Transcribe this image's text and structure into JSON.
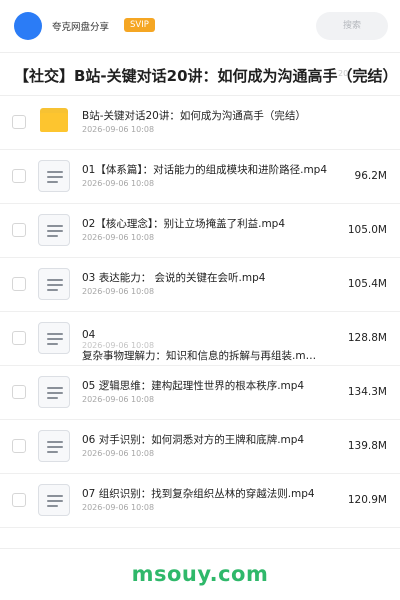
{
  "header": {
    "owner_name": "夸克网盘分享",
    "badge": "SVIP",
    "search_placeholder": "搜索"
  },
  "folder_title": "【社交】B站-关键对话20讲：如何成为沟通高手（完结）",
  "title_overlap_text": "20",
  "files": [
    {
      "name": "B站-关键对话20讲：如何成为沟通高手（完结）",
      "date": "2026-09-06 10:08",
      "size": "",
      "type": "folder"
    },
    {
      "name": "01【体系篇】：对话能力的组成模块和进阶路径.mp4",
      "date": "2026-09-06 10:08",
      "size": "96.2M",
      "type": "file"
    },
    {
      "name": "02【核心理念】：别让立场掩盖了利益.mp4",
      "date": "2026-09-06 10:08",
      "size": "105.0M",
      "type": "file"
    },
    {
      "name": "03 表达能力： 会说的关键在会听.mp4",
      "date": "2026-09-06 10:08",
      "size": "105.4M",
      "type": "file"
    },
    {
      "name": "04",
      "name_line2": "复杂事物理解力：知识和信息的拆解与再组装.m…",
      "date": "2026-09-06 10:08",
      "size": "128.8M",
      "type": "file"
    },
    {
      "name": "05 逻辑思维：建构起理性世界的根本秩序.mp4",
      "date": "2026-09-06 10:08",
      "size": "134.3M",
      "type": "file"
    },
    {
      "name": "06 对手识别：如何洞悉对方的王牌和底牌.mp4",
      "date": "2026-09-06 10:08",
      "size": "139.8M",
      "type": "file"
    },
    {
      "name": "07 组织识别：找到复杂组织丛林的穿越法则.mp4",
      "date": "2026-09-06 10:08",
      "size": "120.9M",
      "type": "file"
    }
  ],
  "watermark": "msouy.com",
  "colors": {
    "accent": "#2b7cf6",
    "badge": "#f5a623",
    "folder": "#fdc52f",
    "watermark": "#2fb86a"
  }
}
